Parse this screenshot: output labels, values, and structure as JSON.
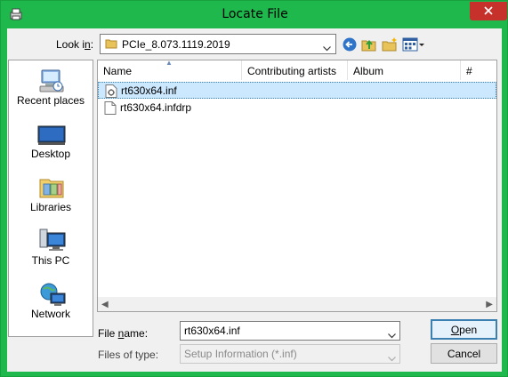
{
  "window": {
    "title": "Locate File"
  },
  "toolbar": {
    "look_in_label": "Look in:",
    "look_in_value": "PCIe_8.073.1119.2019",
    "back_icon": "back-arrow-icon",
    "up_icon": "up-folder-icon",
    "new_folder_icon": "new-folder-icon",
    "view_icon": "view-menu-icon"
  },
  "places": [
    {
      "label": "Recent places",
      "icon": "recent-places-icon"
    },
    {
      "label": "Desktop",
      "icon": "desktop-icon"
    },
    {
      "label": "Libraries",
      "icon": "libraries-icon"
    },
    {
      "label": "This PC",
      "icon": "this-pc-icon"
    },
    {
      "label": "Network",
      "icon": "network-icon"
    }
  ],
  "columns": [
    "Name",
    "Contributing artists",
    "Album",
    "#"
  ],
  "files": [
    {
      "name": "rt630x64.inf",
      "selected": true
    },
    {
      "name": "rt630x64.infdrp",
      "selected": false
    }
  ],
  "form": {
    "file_name_label": "File name:",
    "file_name_value": "rt630x64.inf",
    "file_type_label": "Files of type:",
    "file_type_value": "Setup Information (*.inf)"
  },
  "buttons": {
    "open": "Open",
    "cancel": "Cancel"
  },
  "colors": {
    "titlebar": "#1eb84d",
    "close": "#c7312b",
    "selection": "#cce8ff"
  }
}
